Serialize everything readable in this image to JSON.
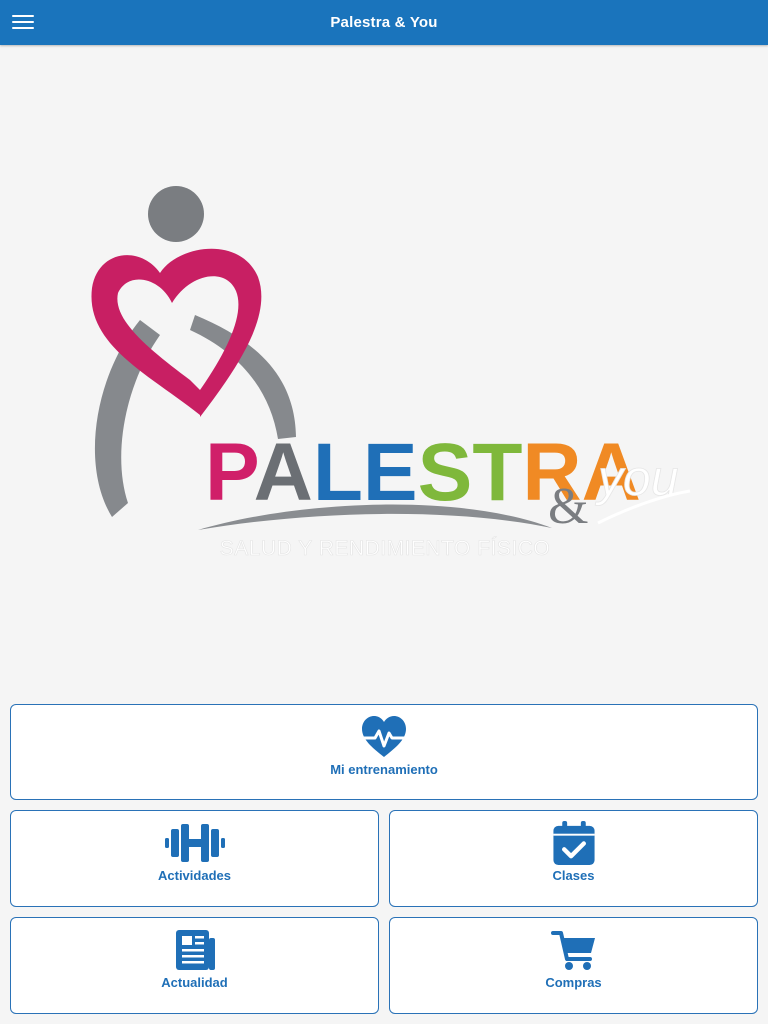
{
  "app": {
    "title": "Palestra & You"
  },
  "logo": {
    "letters": [
      "P",
      "A",
      "L",
      "E",
      "S",
      "T",
      "R",
      "A"
    ],
    "letter_colors": [
      "#d01f69",
      "#6b6f74",
      "#1f6fb7",
      "#1f6fb7",
      "#7fb83b",
      "#7fb83b",
      "#f08a24",
      "#f08a24"
    ],
    "ampersand": "&",
    "you": "you",
    "tagline": "SALUD Y RENDIMIENTO FÍSICO"
  },
  "tiles": {
    "entrenamiento": {
      "label": "Mi entrenamiento",
      "icon": "heartbeat-icon"
    },
    "actividades": {
      "label": "Actividades",
      "icon": "dumbbell-icon"
    },
    "clases": {
      "label": "Clases",
      "icon": "calendar-check-icon"
    },
    "actualidad": {
      "label": "Actualidad",
      "icon": "newspaper-icon"
    },
    "compras": {
      "label": "Compras",
      "icon": "shopping-cart-icon"
    }
  },
  "colors": {
    "header": "#1a74bc",
    "accent": "#1f6fb7",
    "background": "#f5f5f5"
  }
}
